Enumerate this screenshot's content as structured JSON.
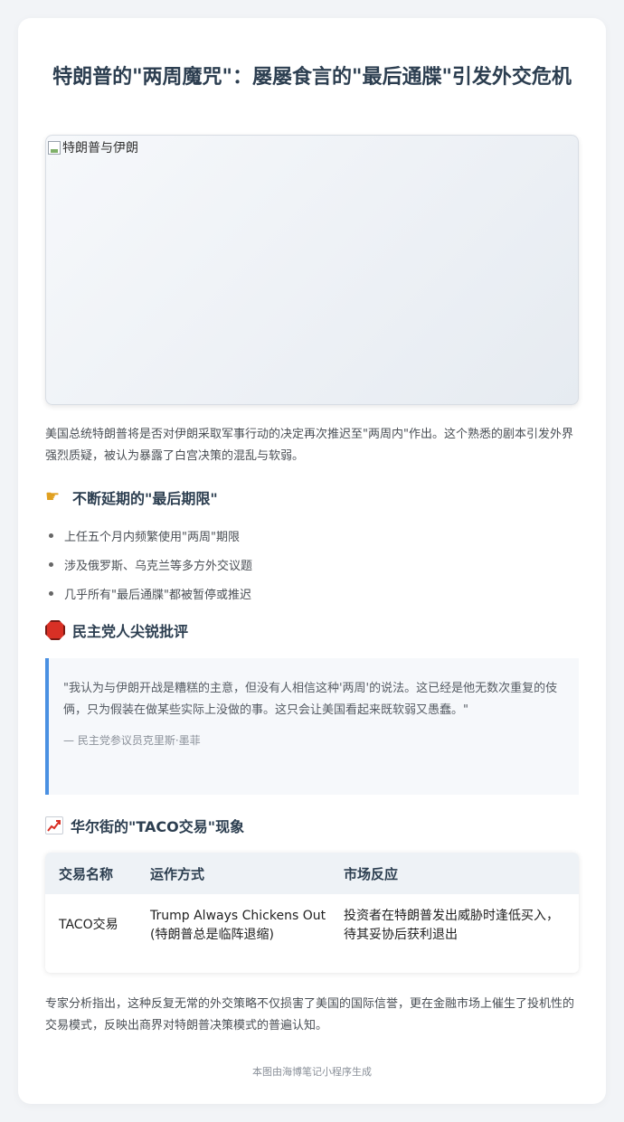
{
  "title": "特朗普的\"两周魔咒\"：屡屡食言的\"最后通牒\"引发外交危机",
  "hero_image": {
    "alt": "特朗普与伊朗"
  },
  "intro": "美国总统特朗普将是否对伊朗采取军事行动的决定再次推迟至\"两周内\"作出。这个熟悉的剧本引发外界强烈质疑，被认为暴露了白宫决策的混乱与软弱。",
  "section1": {
    "icon": "pointing-hand-icon",
    "heading": "不断延期的\"最后期限\"",
    "bullets": [
      "上任五个月内频繁使用\"两周\"期限",
      "涉及俄罗斯、乌克兰等多方外交议题",
      "几乎所有\"最后通牒\"都被暂停或推迟"
    ]
  },
  "section2": {
    "icon": "stop-sign-icon",
    "heading": "民主党人尖锐批评",
    "quote": "\"我认为与伊朗开战是糟糕的主意，但没有人相信这种'两周'的说法。这已经是他无数次重复的伎俩，只为假装在做某些实际上没做的事。这只会让美国看起来既软弱又愚蠢。\"",
    "quote_source": "— 民主党参议员克里斯·墨菲"
  },
  "section3": {
    "icon": "chart-increasing-icon",
    "heading": "华尔街的\"TACO交易\"现象",
    "table": {
      "headers": [
        "交易名称",
        "运作方式",
        "市场反应"
      ],
      "rows": [
        {
          "name": "TACO交易",
          "method_line1": "Trump Always Chickens Out",
          "method_line2": "(特朗普总是临阵退缩)",
          "reaction_line1": "投资者在特朗普发出威胁时逢低买入，",
          "reaction_line2": "待其妥协后获利退出"
        }
      ]
    }
  },
  "conclusion": "专家分析指出，这种反复无常的外交策略不仅损害了美国的国际信誉，更在金融市场上催生了投机性的交易模式，反映出商界对特朗普决策模式的普遍认知。",
  "footer": "本图由海博笔记小程序生成",
  "colors": {
    "accent": "#4a90e2",
    "title": "#2c3e50",
    "stop": "#d93025"
  }
}
